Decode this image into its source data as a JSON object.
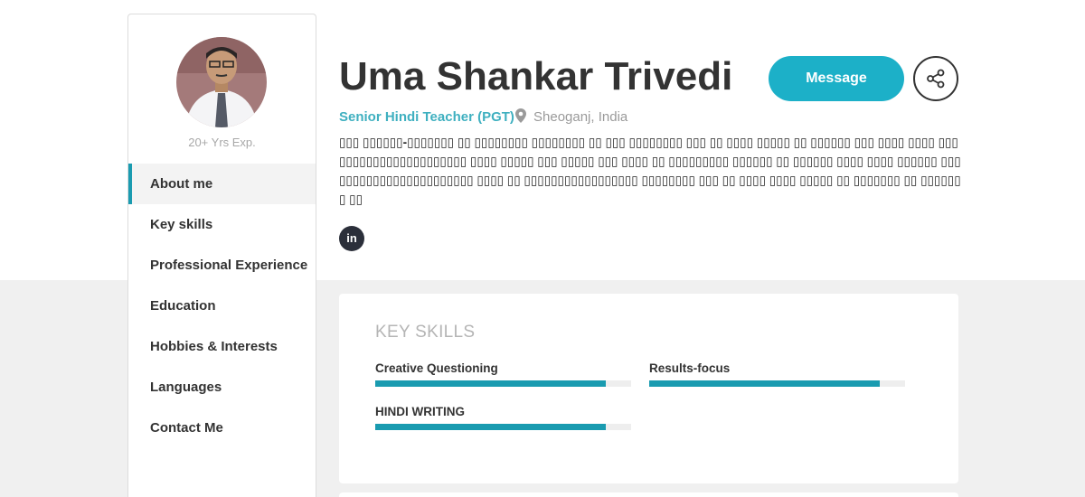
{
  "profile": {
    "name": "Uma Shankar Trivedi",
    "role": "Senior Hindi Teacher (PGT)",
    "location": "Sheoganj, India",
    "experience": "20+ Yrs Exp.",
    "bio": "▯▯▯ ▯▯▯▯▯▯-▯▯▯▯▯▯▯ ▯▯ ▯▯▯▯▯▯▯▯ ▯▯▯▯▯▯▯▯ ▯▯ ▯▯▯ ▯▯▯▯▯▯▯▯ ▯▯▯ ▯▯ ▯▯▯▯ ▯▯▯▯▯ ▯▯ ▯▯▯▯▯▯ ▯▯▯ ▯▯▯▯ ▯▯▯▯ ▯▯▯▯▯▯▯▯▯▯▯▯▯▯▯▯▯▯▯▯▯▯ ▯▯▯▯ ▯▯▯▯▯ ▯▯▯ ▯▯▯▯▯ ▯▯▯ ▯▯▯▯ ▯▯ ▯▯▯▯▯▯▯▯▯ ▯▯▯▯▯▯ ▯▯ ▯▯▯▯▯▯ ▯▯▯▯ ▯▯▯▯ ▯▯▯▯▯▯ ▯▯▯▯▯▯▯▯▯▯▯▯▯▯▯▯▯▯▯▯▯▯▯ ▯▯▯▯ ▯▯ ▯▯▯▯▯▯▯▯▯▯▯▯▯▯▯▯▯ ▯▯▯▯▯▯▯▯ ▯▯▯ ▯▯ ▯▯▯▯ ▯▯▯▯ ▯▯▯▯▯ ▯▯ ▯▯▯▯▯▯▯ ▯▯ ▯▯▯▯▯▯▯ ▯▯"
  },
  "actions": {
    "message_label": "Message",
    "share_icon": "share-icon",
    "linkedin_label": "in"
  },
  "sidebar": {
    "items": [
      {
        "label": "About me",
        "active": true
      },
      {
        "label": "Key skills",
        "active": false
      },
      {
        "label": "Professional Experience",
        "active": false
      },
      {
        "label": "Education",
        "active": false
      },
      {
        "label": "Hobbies & Interests",
        "active": false
      },
      {
        "label": "Languages",
        "active": false
      },
      {
        "label": "Contact Me",
        "active": false
      }
    ]
  },
  "key_skills": {
    "title": "KEY SKILLS",
    "skills": [
      {
        "name": "Creative Questioning",
        "level": 0.9
      },
      {
        "name": "Results-focus",
        "level": 0.9
      },
      {
        "name": "HINDI WRITING",
        "level": 0.9
      }
    ]
  },
  "colors": {
    "accent": "#1cb0c8",
    "bar": "#1a9bb0",
    "role_text": "#3fb0c0"
  }
}
